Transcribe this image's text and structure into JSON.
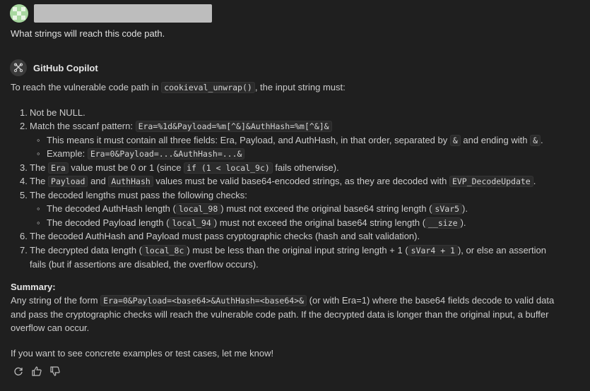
{
  "user": {
    "question": "What strings will reach this code path."
  },
  "assistant": {
    "name": "GitHub Copilot",
    "intro_before": "To reach the vulnerable code path in ",
    "intro_code": "cookieval_unwrap()",
    "intro_after": ", the input string must:",
    "items": [
      {
        "n": "1.",
        "t1": "Not be NULL."
      },
      {
        "n": "2.",
        "t1": "Match the sscanf pattern: ",
        "c1": "Era=%1d&Payload=%m[^&]&AuthHash=%m[^&]&"
      },
      {
        "t1": "This means it must contain all three fields: Era, Payload, and AuthHash, in that order, separated by ",
        "c1": "&",
        "t2": " and ending with ",
        "c2": "&",
        "t3": "."
      },
      {
        "t1": "Example: ",
        "c1": "Era=0&Payload=...&AuthHash=...&"
      },
      {
        "n": "3.",
        "t1": "The ",
        "c1": "Era",
        "t2": " value must be 0 or 1 (since ",
        "c2": "if (1 < local_9c)",
        "t3": " fails otherwise)."
      },
      {
        "n": "4.",
        "t1": "The ",
        "c1": "Payload",
        "t2": " and ",
        "c2": "AuthHash",
        "t3": " values must be valid base64-encoded strings, as they are decoded with ",
        "c3": "EVP_DecodeUpdate",
        "t4": "."
      },
      {
        "n": "5.",
        "t1": "The decoded lengths must pass the following checks:"
      },
      {
        "t1": "The decoded AuthHash length (",
        "c1": "local_98",
        "t2": ") must not exceed the original base64 string length (",
        "c2": "sVar5",
        "t3": ")."
      },
      {
        "t1": "The decoded Payload length (",
        "c1": "local_94",
        "t2": ") must not exceed the original base64 string length (",
        "c2": "__size",
        "t3": ")."
      },
      {
        "n": "6.",
        "t1": "The decoded AuthHash and Payload must pass cryptographic checks (hash and salt validation)."
      },
      {
        "n": "7.",
        "t1": "The decrypted data length (",
        "c1": "local_8c",
        "t2": ") must be less than the original input string length + 1 (",
        "c2": "sVar4 + 1",
        "t3": "), or else an assertion"
      },
      {
        "t1": "fails (but if assertions are disabled, the overflow occurs)."
      }
    ],
    "summary_label": "Summary:",
    "summary_l1_before": "Any string of the form ",
    "summary_l1_code": "Era=0&Payload=<base64>&AuthHash=<base64>&",
    "summary_l1_after": " (or with Era=1) where the base64 fields decode to valid data",
    "summary_l2": "and pass the cryptographic checks will reach the vulnerable code path. If the decrypted data is longer than the original input, a buffer",
    "summary_l3": "overflow can occur.",
    "closing": "If you want to see concrete examples or test cases, let me know!"
  },
  "icons": {
    "avatar": "user-avatar",
    "copilot": "copilot-icon",
    "retry": "retry-icon",
    "thumbs_up": "thumbs-up-icon",
    "thumbs_down": "thumbs-down-icon"
  }
}
